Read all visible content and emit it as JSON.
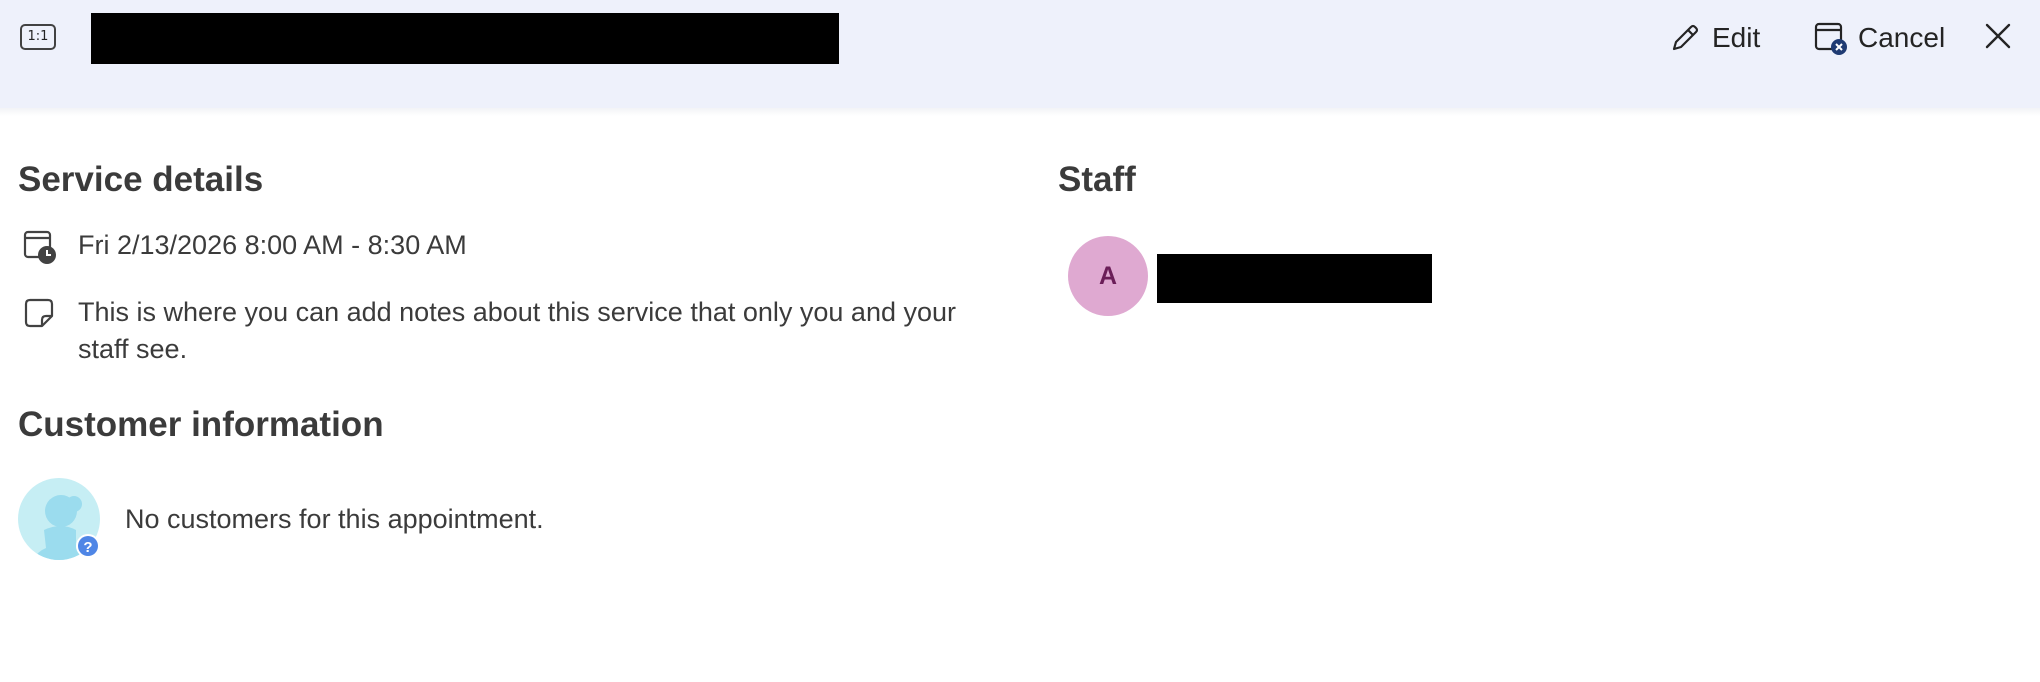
{
  "header": {
    "type_icon_label": "1:1",
    "title": "",
    "edit_label": "Edit",
    "cancel_label": "Cancel",
    "icons": {
      "type": "one-on-one-icon",
      "edit": "pencil-icon",
      "cancel": "calendar-cancel-icon",
      "close": "close-icon"
    }
  },
  "service_details": {
    "heading": "Service details",
    "datetime": "Fri 2/13/2026 8:00 AM - 8:30 AM",
    "notes": "This is where you can add notes about this service that only you and your staff see.",
    "icons": {
      "datetime": "calendar-clock-icon",
      "notes": "note-icon"
    }
  },
  "customer_information": {
    "heading": "Customer information",
    "empty_text": "No customers for this appointment.",
    "icons": {
      "avatar": "unknown-customer-icon",
      "badge": "question-badge-icon"
    }
  },
  "staff": {
    "heading": "Staff",
    "members": [
      {
        "initial": "A",
        "name": ""
      }
    ]
  },
  "colors": {
    "header_bg": "#eef1fb",
    "staff_avatar_bg": "#dfa9d1",
    "staff_avatar_text": "#6b1e58",
    "customer_avatar_bg": "#c6eef4",
    "customer_avatar_figure": "#9bdcee",
    "badge_bg": "#4f86e6"
  }
}
